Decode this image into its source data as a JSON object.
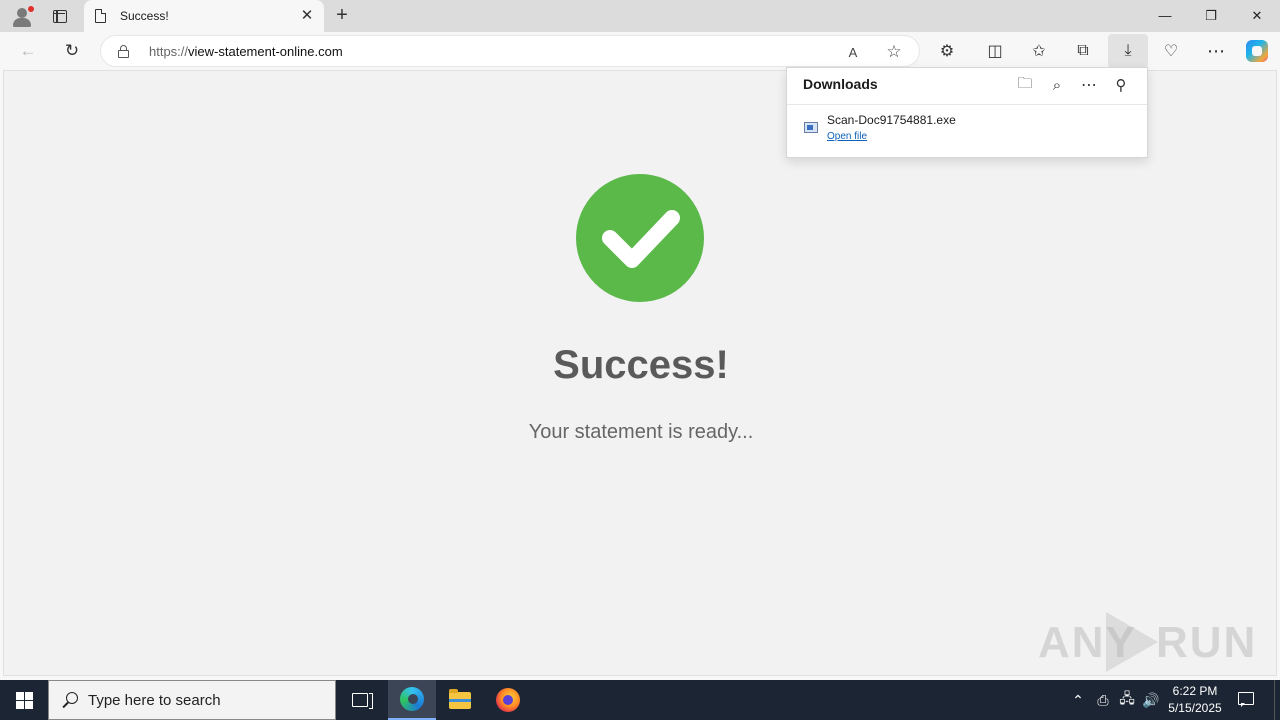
{
  "browser": {
    "tab_title": "Success!",
    "tab_close_glyph": "✕",
    "new_tab_glyph": "+",
    "window_controls": {
      "minimize": "—",
      "maximize": "❐",
      "close": "✕"
    },
    "back_glyph": "←",
    "refresh_glyph": "↻",
    "url_scheme": "https://",
    "url_host": "view-statement-online.com",
    "read_aloud_glyph": "A",
    "favorite_glyph": "☆",
    "toolbar_glyphs": {
      "extensions": "⚙",
      "split_screen": "◫",
      "favorites": "✩",
      "collections": "⧉",
      "downloads": "⤓",
      "browser_essentials": "♡",
      "more": "⋯"
    }
  },
  "downloads_panel": {
    "title": "Downloads",
    "folder_glyph": "🗀",
    "search_glyph": "⌕",
    "more_glyph": "⋯",
    "pin_glyph": "⚲",
    "items": [
      {
        "file_name": "Scan-Doc91754881.exe",
        "action": "Open file"
      }
    ]
  },
  "page": {
    "heading": "Success!",
    "message": "Your statement is ready...",
    "check_color": "#5ab949"
  },
  "watermark": {
    "left": "ANY",
    "right": "RUN"
  },
  "taskbar": {
    "search_placeholder": "Type here to search",
    "tray_up_glyph": "⌃",
    "tray_glyphs": {
      "a": "⎙",
      "b": "🖧",
      "c": "🔊"
    },
    "time": "6:22 PM",
    "date": "5/15/2025"
  }
}
